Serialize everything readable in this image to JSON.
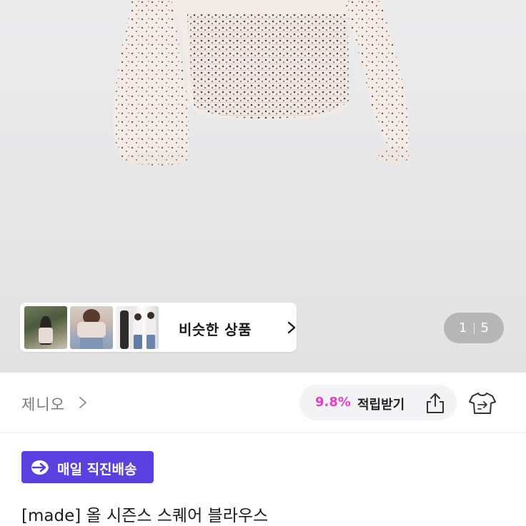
{
  "similar": {
    "label": "비슷한 상품"
  },
  "pager": {
    "current": "1",
    "total": "5"
  },
  "shop": {
    "name": "제니오"
  },
  "reward": {
    "percent": "9.8%",
    "label": "적립받기"
  },
  "delivery_badge": {
    "label": "매일 직진배송",
    "color": "#5b40e0"
  },
  "product": {
    "title": "[made] 올 시즌스 스퀘어 블라우스"
  },
  "colors": {
    "reward_pct": "#e040c9",
    "badge": "#5b40e0"
  },
  "icons": [
    "chevron-right-icon",
    "share-icon",
    "shirt-icon",
    "delivery-arrow-icon"
  ]
}
